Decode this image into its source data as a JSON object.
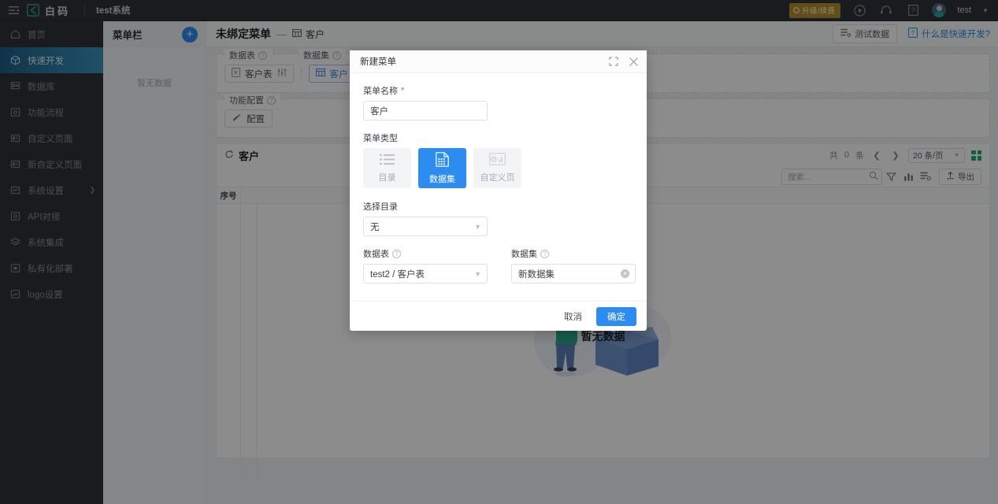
{
  "topbar": {
    "collapse_icon": "menu-collapse-icon",
    "brand_text": "白码",
    "system_name": "test系统",
    "upgrade_badge": "升级/续费",
    "icons": [
      "play-circle-icon",
      "headset-icon",
      "book-help-icon"
    ],
    "user_name": "test"
  },
  "sidebar": {
    "items": [
      {
        "label": "首页",
        "icon": "home-icon",
        "active": false,
        "arrow": false
      },
      {
        "label": "快速开发",
        "icon": "cube-icon",
        "active": true,
        "arrow": false
      },
      {
        "label": "数据库",
        "icon": "database-icon",
        "active": false,
        "arrow": false
      },
      {
        "label": "功能流程",
        "icon": "flow-icon",
        "active": false,
        "arrow": false
      },
      {
        "label": "自定义页面",
        "icon": "custom-page-icon",
        "active": false,
        "arrow": false
      },
      {
        "label": "新自定义页面",
        "icon": "new-custom-page-icon",
        "active": false,
        "arrow": false
      },
      {
        "label": "系统设置",
        "icon": "settings-icon",
        "active": false,
        "arrow": true
      },
      {
        "label": "API对接",
        "icon": "api-icon",
        "active": false,
        "arrow": false
      },
      {
        "label": "系统集成",
        "icon": "integration-icon",
        "active": false,
        "arrow": false
      },
      {
        "label": "私有化部署",
        "icon": "deploy-icon",
        "active": false,
        "arrow": false
      },
      {
        "label": "logo设置",
        "icon": "logo-settings-icon",
        "active": false,
        "arrow": false
      }
    ]
  },
  "menu_panel": {
    "title": "菜单栏",
    "add_label": "+",
    "empty_text": "暂无数据"
  },
  "main": {
    "header": {
      "title": "未绑定菜单",
      "dash": "—",
      "sub_label": "客户",
      "sub_icon": "table-icon",
      "test_data_button": "测试数据",
      "help_link": "什么是快速开发?"
    },
    "datasource": {
      "legend_table": "数据表",
      "legend_dataset": "数据集",
      "chip_table": "客户表",
      "chip_dataset": "客户"
    },
    "feature": {
      "legend": "功能配置",
      "config_button": "配置"
    },
    "datacard": {
      "title": "客户",
      "refresh_icon": "refresh-icon",
      "total_prefix": "共",
      "total_count": "0",
      "total_suffix": "条",
      "page_size": "20 条/页",
      "search_placeholder": "搜索...",
      "export_button": "导出",
      "tools": [
        "filter-icon",
        "chart-icon",
        "settings-list-icon"
      ],
      "column_index": "序号",
      "empty_text": "暂无数据"
    }
  },
  "modal": {
    "title": "新建菜单",
    "fullscreen_icon": "fullscreen-icon",
    "close_icon": "close-icon",
    "name_label": "菜单名称",
    "name_required": "*",
    "name_value": "客户",
    "type_label": "菜单类型",
    "types": [
      {
        "label": "目录",
        "icon": "list-icon",
        "selected": false
      },
      {
        "label": "数据集",
        "icon": "dataset-icon",
        "selected": true
      },
      {
        "label": "自定义页",
        "icon": "custom-dashboard-icon",
        "selected": false
      }
    ],
    "catalog_label": "选择目录",
    "catalog_value": "无",
    "table_label": "数据表",
    "table_value": "test2 / 客户表",
    "dataset_label": "数据集",
    "dataset_value": "新数据集",
    "cancel_label": "取消",
    "confirm_label": "确定"
  },
  "colors": {
    "accent": "#2d8cf0",
    "topbar_bg": "#2e3238",
    "sidebar_active": "#2d7fa8",
    "badge": "#b08d2a",
    "green": "#17b26a"
  }
}
